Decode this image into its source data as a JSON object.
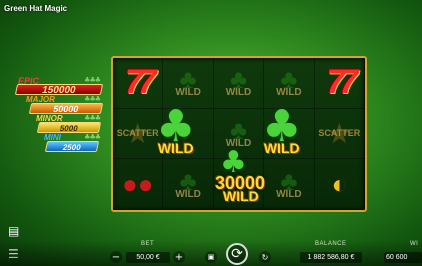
{
  "app": {
    "title": "Green Hat Magic"
  },
  "jackpots": [
    {
      "name": "EPIC",
      "value": "150000",
      "clovers": "♣♣♣"
    },
    {
      "name": "MAJOR",
      "value": "50000",
      "clovers": "♣♣♣"
    },
    {
      "name": "MINOR",
      "value": "5000",
      "clovers": "♣♣♣"
    },
    {
      "name": "MINI",
      "value": "2500",
      "clovers": "♣♣♣"
    }
  ],
  "reels": {
    "wild_label": "WILD",
    "scatter_label": "SCATTER",
    "seven": "77",
    "win_amount": "30000",
    "big_wild_label": "WILD"
  },
  "bottom": {
    "bet_label": "BET",
    "bet_value": "50,00 €",
    "balance_label": "BALANCE",
    "balance_value": "1 882 586,80 €",
    "win_label": "WI",
    "win_value": "60 600",
    "minus": "−",
    "plus": "+"
  },
  "colors": {
    "frame": "#d8a32c",
    "epic": "#e02020",
    "major": "#ff9a1e",
    "minor": "#ffd24a",
    "mini": "#4ab7ff"
  }
}
